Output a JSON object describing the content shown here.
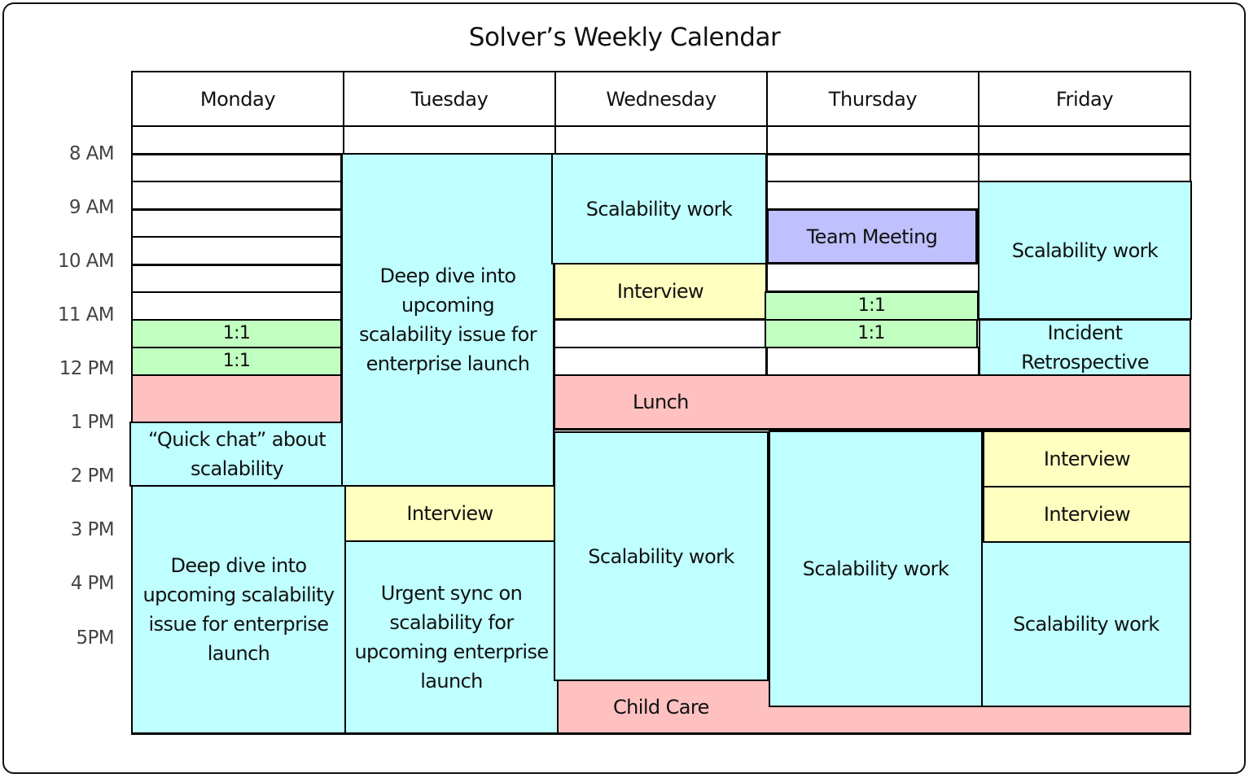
{
  "title": "Solver’s Weekly Calendar",
  "days": [
    "Monday",
    "Tuesday",
    "Wednesday",
    "Thursday",
    "Friday"
  ],
  "time_labels": [
    "8 AM",
    "9 AM",
    "10 AM",
    "11 AM",
    "12 PM",
    "1 PM",
    "2 PM",
    "3 PM",
    "4 PM",
    "5PM"
  ],
  "colors": {
    "scalability": "#bfffff",
    "interview": "#ffffc0",
    "one_on_one": "#c0ffc0",
    "personal": "#ffc0c0",
    "team_meeting": "#c0c0ff"
  },
  "events": {
    "mon_1on1_a": {
      "day": "Monday",
      "label": "1:1",
      "start": "11:00 AM",
      "end": "11:30 AM",
      "category": "one_on_one"
    },
    "mon_1on1_b": {
      "day": "Monday",
      "label": "1:1",
      "start": "11:30 AM",
      "end": "12:00 PM",
      "category": "one_on_one"
    },
    "mon_lunch": {
      "day": "Monday",
      "label": "",
      "start": "12:00 PM",
      "end": "1:00 PM",
      "category": "personal"
    },
    "mon_quick_chat": {
      "day": "Monday",
      "label": "“Quick chat” about scalability",
      "start": "1:00 PM",
      "end": "2:00 PM",
      "category": "scalability"
    },
    "mon_deep_dive": {
      "day": "Monday",
      "label": "Deep dive into upcoming scalability issue for enterprise launch",
      "start": "2:00 PM",
      "end": "6:30 PM",
      "category": "scalability"
    },
    "tue_deep_dive": {
      "day": "Tuesday",
      "label": "Deep dive into upcoming scalability issue for enterprise launch",
      "start": "8:00 AM",
      "end": "2:30 PM",
      "category": "scalability"
    },
    "tue_interview": {
      "day": "Tuesday",
      "label": "Interview",
      "start": "2:30 PM",
      "end": "3:00 PM",
      "category": "interview"
    },
    "tue_urgent_sync": {
      "day": "Tuesday",
      "label": "Urgent sync on scalability for upcoming enterprise launch",
      "start": "3:00 PM",
      "end": "6:30 PM",
      "category": "scalability"
    },
    "wed_scalability_am": {
      "day": "Wednesday",
      "label": "Scalability work",
      "start": "8:00 AM",
      "end": "10:00 AM",
      "category": "scalability"
    },
    "wed_interview": {
      "day": "Wednesday",
      "label": "Interview",
      "start": "10:00 AM",
      "end": "11:00 AM",
      "category": "interview"
    },
    "lunch": {
      "day": "Wednesday–Friday",
      "label": "Lunch",
      "start": "12:00 PM",
      "end": "1:00 PM",
      "category": "personal"
    },
    "wed_scalability_pm": {
      "day": "Wednesday",
      "label": "Scalability work",
      "start": "1:00 PM",
      "end": "5:30 PM",
      "category": "scalability"
    },
    "child_care": {
      "day": "Wednesday–Friday",
      "label": "Child Care",
      "start": "5:30 PM",
      "end": "6:30 PM",
      "category": "personal"
    },
    "thu_team_meeting": {
      "day": "Thursday",
      "label": "Team Meeting",
      "start": "9:00 AM",
      "end": "10:00 AM",
      "category": "team_meeting"
    },
    "thu_1on1_a": {
      "day": "Thursday",
      "label": "1:1",
      "start": "10:30 AM",
      "end": "11:00 AM",
      "category": "one_on_one"
    },
    "thu_1on1_b": {
      "day": "Thursday",
      "label": "1:1",
      "start": "11:00 AM",
      "end": "11:30 AM",
      "category": "one_on_one"
    },
    "thu_scalability_pm": {
      "day": "Thursday",
      "label": "Scalability work",
      "start": "1:00 PM",
      "end": "6:00 PM",
      "category": "scalability"
    },
    "fri_scalability_am": {
      "day": "Friday",
      "label": "Scalability work",
      "start": "8:30 AM",
      "end": "11:00 AM",
      "category": "scalability"
    },
    "fri_incident_retro": {
      "day": "Friday",
      "label": "Incident Retrospective",
      "start": "11:00 AM",
      "end": "12:00 PM",
      "category": "scalability"
    },
    "fri_interview_a": {
      "day": "Friday",
      "label": "Interview",
      "start": "1:00 PM",
      "end": "2:00 PM",
      "category": "interview"
    },
    "fri_interview_b": {
      "day": "Friday",
      "label": "Interview",
      "start": "2:00 PM",
      "end": "3:00 PM",
      "category": "interview"
    },
    "fri_scalability_pm": {
      "day": "Friday",
      "label": "Scalability work",
      "start": "3:00 PM",
      "end": "6:00 PM",
      "category": "scalability"
    }
  }
}
